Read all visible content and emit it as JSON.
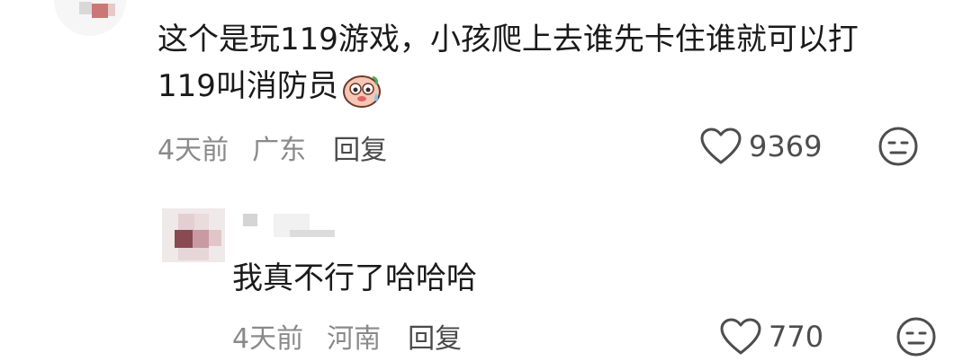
{
  "comment1": {
    "line1": "这个是玩119游戏，小孩爬上去谁先卡住谁就可以打",
    "line2": "119叫消防员",
    "sticker_icon": "sweating-face-sticker",
    "time": "4天前",
    "location": "广东",
    "reply_label": "回复",
    "likes": "9369"
  },
  "reply1": {
    "text": "我真不行了哈哈哈",
    "time": "4天前",
    "location": "河南",
    "reply_label": "回复",
    "likes": "770"
  },
  "icons": {
    "like": "heart-outline-icon",
    "dislike": "unamused-face-icon"
  },
  "colors": {
    "text": "#1a1a1a",
    "meta": "#8a8a8a",
    "icon": "#4d4d4d"
  }
}
